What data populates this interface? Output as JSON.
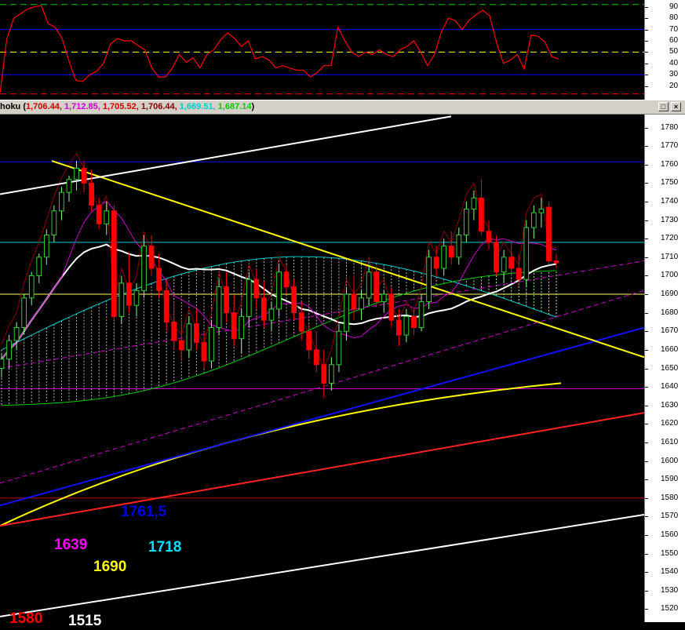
{
  "header": {
    "indicator_name": "hoku (",
    "values": [
      {
        "text": "1,706.44, ",
        "color": "#cc0000"
      },
      {
        "text": "1,712.85, ",
        "color": "#cc00cc"
      },
      {
        "text": "1,705.52, ",
        "color": "#cc0000"
      },
      {
        "text": "1,706.44, ",
        "color": "#880000"
      },
      {
        "text": "1,669.51, ",
        "color": "#00cccc"
      },
      {
        "text": "1,687.14",
        "color": "#00cc00"
      }
    ],
    "close_paren": ")",
    "buttons": [
      {
        "name": "restore-button",
        "label": "□"
      },
      {
        "name": "close-button",
        "label": "×"
      }
    ]
  },
  "chart_data": [
    {
      "type": "line",
      "panel": "oscillator",
      "y_ticks": [
        20,
        30,
        40,
        50,
        60,
        70,
        80,
        90
      ],
      "ylim": [
        8,
        96
      ],
      "horizontal_levels": [
        {
          "value": 92,
          "color": "#00cc00",
          "style": "dashed"
        },
        {
          "value": 70,
          "color": "#0000ff",
          "style": "solid"
        },
        {
          "value": 50,
          "color": "#ffff00",
          "style": "dashed"
        },
        {
          "value": 30,
          "color": "#0000ff",
          "style": "solid"
        },
        {
          "value": 13,
          "color": "#ff0000",
          "style": "dashed"
        }
      ],
      "series": [
        {
          "color": "#ff0000",
          "values": [
            14,
            62,
            80,
            84,
            88,
            90,
            91,
            75,
            72,
            62,
            42,
            25,
            24,
            30,
            33,
            40,
            57,
            62,
            60,
            60,
            56,
            52,
            36,
            28,
            28,
            36,
            48,
            41,
            45,
            36,
            48,
            52,
            61,
            67,
            62,
            55,
            60,
            44,
            46,
            43,
            36,
            38,
            36,
            34,
            34,
            28,
            32,
            38,
            38,
            72,
            60,
            50,
            46,
            50,
            48,
            52,
            48,
            46,
            52,
            55,
            60,
            50,
            38,
            48,
            68,
            80,
            78,
            70,
            78,
            83,
            87,
            82,
            58,
            40,
            43,
            48,
            35,
            65,
            64,
            59,
            46,
            44
          ]
        }
      ]
    },
    {
      "type": "candlestick",
      "panel": "price",
      "y_ticks": [
        1520,
        1530,
        1540,
        1550,
        1560,
        1570,
        1580,
        1590,
        1600,
        1610,
        1620,
        1630,
        1640,
        1650,
        1660,
        1670,
        1680,
        1690,
        1700,
        1710,
        1720,
        1730,
        1740,
        1750,
        1760,
        1770,
        1780
      ],
      "ylim": [
        1513,
        1787
      ],
      "candles": [
        [
          1650,
          1658,
          1645,
          1655
        ],
        [
          1655,
          1668,
          1650,
          1665
        ],
        [
          1665,
          1675,
          1660,
          1672
        ],
        [
          1672,
          1690,
          1668,
          1688
        ],
        [
          1688,
          1702,
          1684,
          1700
        ],
        [
          1700,
          1712,
          1696,
          1710
        ],
        [
          1710,
          1725,
          1706,
          1722
        ],
        [
          1722,
          1738,
          1718,
          1735
        ],
        [
          1735,
          1748,
          1730,
          1745
        ],
        [
          1745,
          1754,
          1740,
          1752
        ],
        [
          1752,
          1762,
          1746,
          1758
        ],
        [
          1758,
          1762,
          1745,
          1750
        ],
        [
          1750,
          1757,
          1735,
          1738
        ],
        [
          1738,
          1742,
          1725,
          1728
        ],
        [
          1728,
          1740,
          1722,
          1735
        ],
        [
          1735,
          1738,
          1676,
          1678
        ],
        [
          1678,
          1700,
          1674,
          1696
        ],
        [
          1696,
          1712,
          1680,
          1684
        ],
        [
          1684,
          1696,
          1678,
          1692
        ],
        [
          1692,
          1722,
          1688,
          1716
        ],
        [
          1716,
          1722,
          1700,
          1704
        ],
        [
          1704,
          1712,
          1688,
          1692
        ],
        [
          1692,
          1698,
          1670,
          1675
        ],
        [
          1675,
          1686,
          1660,
          1665
        ],
        [
          1665,
          1676,
          1654,
          1660
        ],
        [
          1660,
          1678,
          1656,
          1674
        ],
        [
          1674,
          1682,
          1660,
          1664
        ],
        [
          1664,
          1670,
          1650,
          1654
        ],
        [
          1654,
          1676,
          1650,
          1672
        ],
        [
          1672,
          1698,
          1668,
          1694
        ],
        [
          1694,
          1702,
          1675,
          1680
        ],
        [
          1680,
          1690,
          1662,
          1666
        ],
        [
          1666,
          1682,
          1658,
          1678
        ],
        [
          1678,
          1702,
          1672,
          1698
        ],
        [
          1698,
          1704,
          1682,
          1688
        ],
        [
          1688,
          1697,
          1672,
          1676
        ],
        [
          1676,
          1686,
          1670,
          1682
        ],
        [
          1682,
          1706,
          1678,
          1702
        ],
        [
          1702,
          1706,
          1690,
          1694
        ],
        [
          1694,
          1698,
          1676,
          1680
        ],
        [
          1680,
          1686,
          1665,
          1670
        ],
        [
          1670,
          1674,
          1655,
          1660
        ],
        [
          1660,
          1670,
          1648,
          1652
        ],
        [
          1652,
          1660,
          1634,
          1642
        ],
        [
          1642,
          1656,
          1638,
          1652
        ],
        [
          1652,
          1674,
          1648,
          1670
        ],
        [
          1670,
          1694,
          1665,
          1690
        ],
        [
          1690,
          1700,
          1676,
          1682
        ],
        [
          1682,
          1692,
          1676,
          1688
        ],
        [
          1688,
          1706,
          1684,
          1702
        ],
        [
          1702,
          1705,
          1683,
          1686
        ],
        [
          1686,
          1692,
          1680,
          1690
        ],
        [
          1690,
          1694,
          1672,
          1676
        ],
        [
          1676,
          1682,
          1662,
          1668
        ],
        [
          1668,
          1682,
          1664,
          1678
        ],
        [
          1678,
          1682,
          1668,
          1672
        ],
        [
          1672,
          1690,
          1670,
          1686
        ],
        [
          1686,
          1714,
          1682,
          1710
        ],
        [
          1710,
          1716,
          1700,
          1704
        ],
        [
          1704,
          1720,
          1700,
          1716
        ],
        [
          1716,
          1724,
          1706,
          1710
        ],
        [
          1710,
          1726,
          1706,
          1722
        ],
        [
          1722,
          1740,
          1718,
          1736
        ],
        [
          1736,
          1746,
          1730,
          1742
        ],
        [
          1742,
          1752,
          1722,
          1724
        ],
        [
          1724,
          1730,
          1714,
          1718
        ],
        [
          1718,
          1722,
          1700,
          1702
        ],
        [
          1702,
          1714,
          1696,
          1710
        ],
        [
          1710,
          1718,
          1700,
          1704
        ],
        [
          1704,
          1712,
          1694,
          1698
        ],
        [
          1698,
          1730,
          1694,
          1726
        ],
        [
          1726,
          1738,
          1720,
          1734
        ],
        [
          1734,
          1742,
          1726,
          1736
        ],
        [
          1737,
          1740,
          1706,
          1708
        ],
        [
          1708,
          1712,
          1704,
          1707
        ]
      ],
      "colors": {
        "up": "#33cc33",
        "down": "#ff0000",
        "up_wick": "#88ff88"
      }
    }
  ],
  "annotations": [
    {
      "text": "1761,5",
      "color": "#0000dd"
    },
    {
      "text": "1639",
      "color": "#ff00ff"
    },
    {
      "text": "1718",
      "color": "#00e0ff"
    },
    {
      "text": "1690",
      "color": "#ffff00"
    },
    {
      "text": "1580",
      "color": "#ff0000"
    },
    {
      "text": "1515",
      "color": "#ffffff"
    }
  ]
}
